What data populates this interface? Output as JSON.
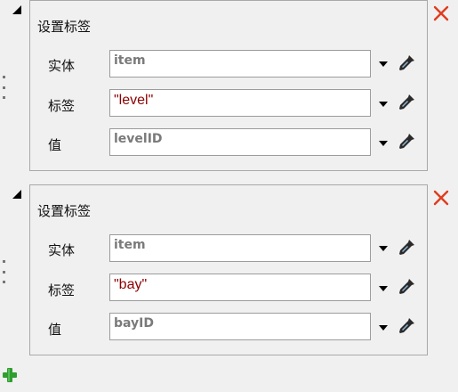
{
  "blocks": [
    {
      "title": "设置标签",
      "rows": [
        {
          "label": "实体",
          "value": "item",
          "kind": "expr"
        },
        {
          "label": "标签",
          "value": "\"level\"",
          "kind": "string"
        },
        {
          "label": "值",
          "value": "levelID",
          "kind": "expr"
        }
      ]
    },
    {
      "title": "设置标签",
      "rows": [
        {
          "label": "实体",
          "value": "item",
          "kind": "expr"
        },
        {
          "label": "标签",
          "value": "\"bay\"",
          "kind": "string"
        },
        {
          "label": "值",
          "value": "bayID",
          "kind": "expr"
        }
      ]
    }
  ],
  "icons": {
    "close": "close-icon",
    "collapse": "collapse-triangle-icon",
    "dropdown": "chevron-down-icon",
    "picker": "eyedropper-icon",
    "add": "plus-icon",
    "drag": "drag-handle-icon"
  },
  "colors": {
    "close": "#e03c1e",
    "add": "#2e9e2e",
    "string_text": "#8b0000",
    "expr_text": "#7a7a7a"
  }
}
